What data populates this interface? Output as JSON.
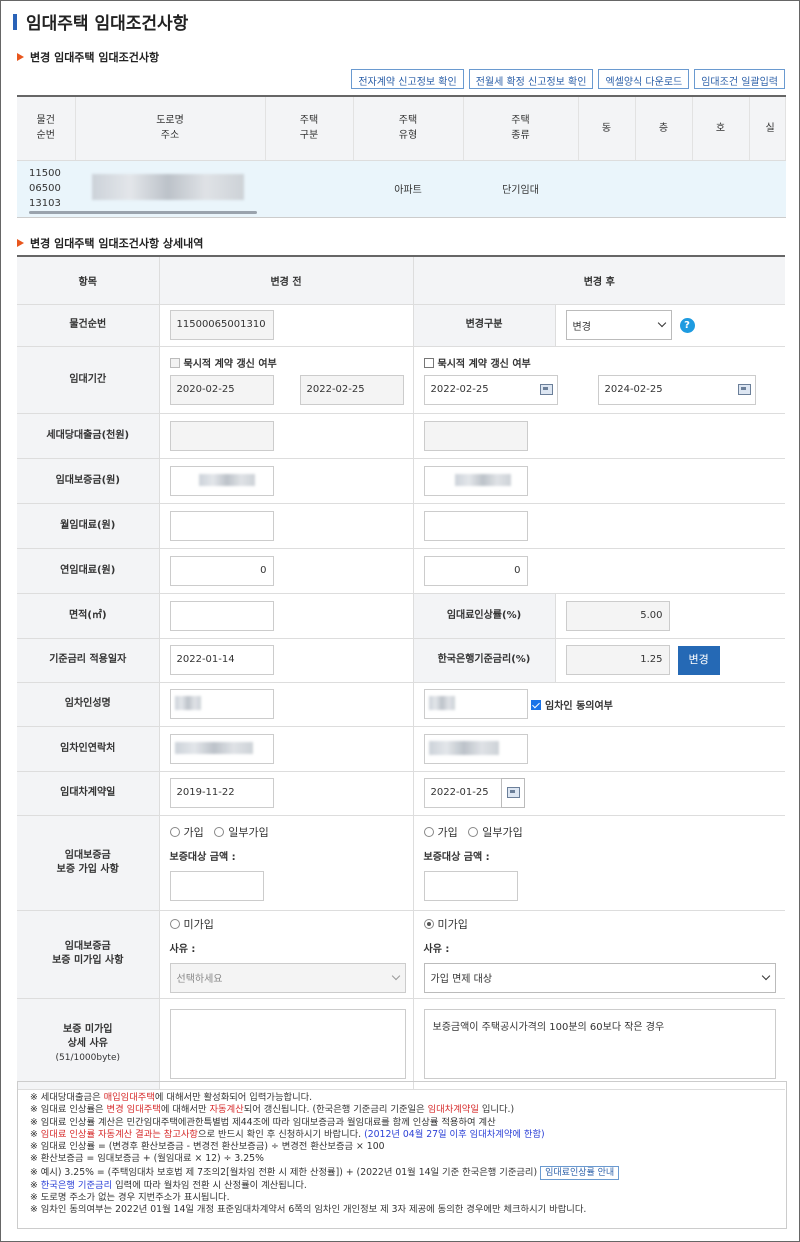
{
  "page": {
    "title": "임대주택 임대조건사항"
  },
  "sec1": {
    "title": "변경 임대주택 임대조건사항"
  },
  "sec2": {
    "title": "변경 임대주택 임대조건사항 상세내역"
  },
  "buttons": {
    "b1": "전자계약 신고정보 확인",
    "b2": "전월세 확정 신고정보 확인",
    "b3": "엑셀양식 다운로드",
    "b4": "임대조건 일괄입력"
  },
  "list": {
    "headers": {
      "h1a": "물건",
      "h1b": "순번",
      "h2a": "도로명",
      "h2b": "주소",
      "h3a": "주택",
      "h3b": "구분",
      "h4a": "주택",
      "h4b": "유형",
      "h5a": "주택",
      "h5b": "종류",
      "h6": "동",
      "h7": "층",
      "h8": "호",
      "h9": "실"
    },
    "row": {
      "no1": "11500",
      "no2": "06500",
      "no3": "13103",
      "type": "아파트",
      "kind": "단기임대"
    }
  },
  "detail": {
    "head": {
      "item": "항목",
      "before": "변경 전",
      "after": "변경 후"
    },
    "labels": {
      "serial": "물건순번",
      "change_type": "변경구분",
      "period": "임대기간",
      "loan": "세대당대출금(천원)",
      "deposit": "임대보증금(원)",
      "monthly": "월임대료(원)",
      "yearly": "연임대료(원)",
      "area": "면적(㎡)",
      "raise": "임대료인상률(%)",
      "base_date": "기준금리 적용일자",
      "bok_rate": "한국은행기준금리(%)",
      "tenant": "임차인성명",
      "contact": "임차인연락처",
      "contract_date": "임대차계약일",
      "ins1": "임대보증금",
      "ins2": "보증 가입 사항",
      "noins1": "임대보증금",
      "noins2": "보증 미가입 사항",
      "reason1": "보증 미가입",
      "reason2": "상세 사유",
      "reason3": "(51/1000byte)"
    },
    "units": {
      "thousand": "천원",
      "won": "원",
      "sqm": "㎡",
      "pct": "%",
      "dash": "-"
    },
    "before": {
      "serial": "11500065001310",
      "implicit": "묵시적 계약 갱신 여부",
      "start": "2020-02-25",
      "end": "2022-02-25",
      "yearly": "0",
      "base_date": "2022-01-14",
      "contract_date": "2019-11-22",
      "reason_select": "선택하세요"
    },
    "after": {
      "change_type": "변경",
      "implicit": "묵시적 계약 갱신 여부",
      "start": "2022-02-25",
      "end": "2024-02-25",
      "yearly": "0",
      "raise": "5.00",
      "bok_rate": "1.25",
      "consent": "임차인 동의여부",
      "contract_date": "2022-01-25",
      "reason_select": "가입 면제 대상",
      "reason_text": "보증금액이 주택공시가격의 100분의 60보다 작은 경우"
    },
    "common": {
      "join": "가입",
      "partial": "일부가입",
      "target_amount": "보증대상 금액 :",
      "not_join": "미가입",
      "reason": "사유 :",
      "change_btn": "변경",
      "help": "?"
    }
  },
  "notes": {
    "n1a": "※ 세대당대출금은 ",
    "n1b": "매입임대주택",
    "n1c": "에 대해서만 활성화되어 입력가능합니다.",
    "n2a": "※ 임대료 인상률은 ",
    "n2b": "변경 임대주택",
    "n2c": "에 대해서만 ",
    "n2d": "자동계산",
    "n2e": "되어 갱신됩니다. (한국은행 기준금리 기준일은 ",
    "n2f": "임대차계약일",
    "n2g": " 입니다.)",
    "n3": "※ 임대료 인상률 계산은 민간임대주택에관한특별법 제44조에 따라 임대보증금과 월임대료를 함께 인상률 적용하여 계산",
    "n4a": "※ ",
    "n4b": "임대료 인상률 자동계산 결과는 참고사항",
    "n4c": "으로 반드시 확인 후 신청하시기 바랍니다. ",
    "n4d": "(2012년 04월 27일 이후 임대차계약에 한함)",
    "n5": "※ 임대료 인상률 = (변경후 환산보증금 - 변경전 환산보증금) ÷ 변경전 환산보증금 × 100",
    "n6": "※ 환산보증금 = 임대보증금 + (월임대료 × 12) ÷ 3.25%",
    "n7": "※ 예시) 3.25% = (주택임대차 보호법 제 7조의2[월차임 전환 시 제한 산정률]) + (2022년 01월 14일 기준 한국은행 기준금리)",
    "n7btn": "임대료인상률 안내",
    "n8a": "※ ",
    "n8b": "한국은행 기준금리",
    "n8c": " 입력에 따라 월차임 전환 시 산정률이 계산됩니다.",
    "n9": "※ 도로명 주소가 없는 경우 지번주소가 표시됩니다.",
    "n10": "※ 임차인 동의여부는 2022년 01월 14일 개정 표준임대차계약서 6쪽의 임차인 개인정보 제 3자 제공에 동의한 경우에만 체크하시기 바랍니다."
  }
}
